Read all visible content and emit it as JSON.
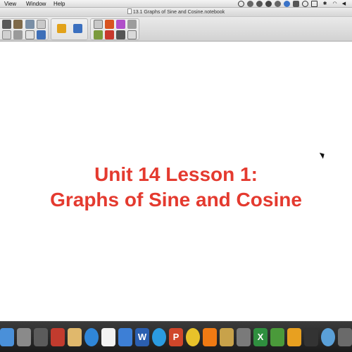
{
  "menubar": {
    "items": [
      "View",
      "Window",
      "Help"
    ]
  },
  "window": {
    "title": "13.1 Graphs of Sine and Cosine.notebook"
  },
  "slide": {
    "title_line1": "Unit 14 Lesson 1:",
    "title_line2": "Graphs of Sine and Cosine",
    "title_color": "#e43a2f"
  },
  "toolbar": {
    "tools": [
      "page-sorter-icon",
      "gallery-icon",
      "attachments-icon",
      "properties-icon",
      "screen-shade-icon",
      "table-icon",
      "close-icon",
      "record-icon",
      "plugin-icon",
      "select-icon",
      "pen-icon",
      "eraser-icon",
      "shape-icon",
      "text-icon",
      "line-icon",
      "fill-icon"
    ]
  },
  "dock": {
    "apps": [
      "finder-icon",
      "launchpad-icon",
      "rocket-icon",
      "safari-icon",
      "mail-icon",
      "contacts-icon",
      "calendar-icon",
      "notes-icon",
      "reminders-icon",
      "word-icon",
      "app-store-icon",
      "powerpoint-icon",
      "chrome-icon",
      "vlc-icon",
      "smart-notebook-icon",
      "itunes-icon",
      "excel-icon",
      "numbers-icon",
      "calculator-icon",
      "quicktime-icon",
      "preview-icon"
    ]
  }
}
